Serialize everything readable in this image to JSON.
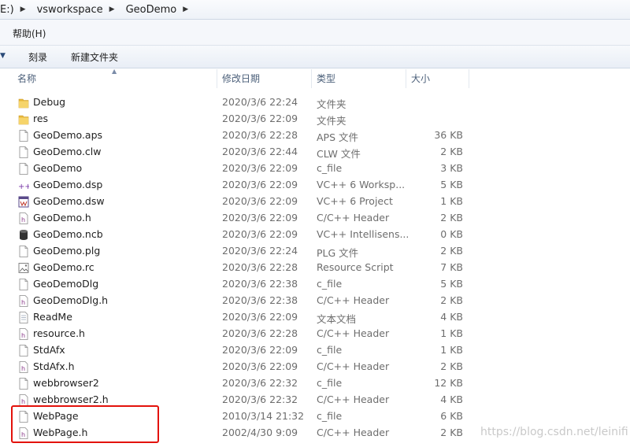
{
  "address": {
    "drive": "E:)",
    "crumbs": [
      "vsworkspace",
      "GeoDemo"
    ]
  },
  "menu": {
    "help": "帮助(H)"
  },
  "toolbar": {
    "burn": "刻录",
    "new_folder": "新建文件夹"
  },
  "columns": {
    "name": "名称",
    "date": "修改日期",
    "type": "类型",
    "size": "大小"
  },
  "files": [
    {
      "name": "Debug",
      "date": "2020/3/6 22:24",
      "type": "文件夹",
      "size": "",
      "icon": "folder-icon"
    },
    {
      "name": "res",
      "date": "2020/3/6 22:09",
      "type": "文件夹",
      "size": "",
      "icon": "folder-icon"
    },
    {
      "name": "GeoDemo.aps",
      "date": "2020/3/6 22:28",
      "type": "APS 文件",
      "size": "36 KB",
      "icon": "file-icon"
    },
    {
      "name": "GeoDemo.clw",
      "date": "2020/3/6 22:44",
      "type": "CLW 文件",
      "size": "2 KB",
      "icon": "file-icon"
    },
    {
      "name": "GeoDemo",
      "date": "2020/3/6 22:09",
      "type": "c_file",
      "size": "3 KB",
      "icon": "file-icon"
    },
    {
      "name": "GeoDemo.dsp",
      "date": "2020/3/6 22:09",
      "type": "VC++ 6 Worksp...",
      "size": "5 KB",
      "icon": "vc-project-icon"
    },
    {
      "name": "GeoDemo.dsw",
      "date": "2020/3/6 22:09",
      "type": "VC++ 6 Project",
      "size": "1 KB",
      "icon": "vc-workspace-icon"
    },
    {
      "name": "GeoDemo.h",
      "date": "2020/3/6 22:09",
      "type": "C/C++ Header",
      "size": "2 KB",
      "icon": "header-file-icon"
    },
    {
      "name": "GeoDemo.ncb",
      "date": "2020/3/6 22:09",
      "type": "VC++ Intellisens...",
      "size": "0 KB",
      "icon": "database-icon"
    },
    {
      "name": "GeoDemo.plg",
      "date": "2020/3/6 22:24",
      "type": "PLG 文件",
      "size": "2 KB",
      "icon": "file-icon"
    },
    {
      "name": "GeoDemo.rc",
      "date": "2020/3/6 22:28",
      "type": "Resource Script",
      "size": "7 KB",
      "icon": "resource-script-icon"
    },
    {
      "name": "GeoDemoDlg",
      "date": "2020/3/6 22:38",
      "type": "c_file",
      "size": "5 KB",
      "icon": "file-icon"
    },
    {
      "name": "GeoDemoDlg.h",
      "date": "2020/3/6 22:38",
      "type": "C/C++ Header",
      "size": "2 KB",
      "icon": "header-file-icon"
    },
    {
      "name": "ReadMe",
      "date": "2020/3/6 22:09",
      "type": "文本文档",
      "size": "4 KB",
      "icon": "text-file-icon"
    },
    {
      "name": "resource.h",
      "date": "2020/3/6 22:28",
      "type": "C/C++ Header",
      "size": "1 KB",
      "icon": "header-file-icon"
    },
    {
      "name": "StdAfx",
      "date": "2020/3/6 22:09",
      "type": "c_file",
      "size": "1 KB",
      "icon": "file-icon"
    },
    {
      "name": "StdAfx.h",
      "date": "2020/3/6 22:09",
      "type": "C/C++ Header",
      "size": "2 KB",
      "icon": "header-file-icon"
    },
    {
      "name": "webbrowser2",
      "date": "2020/3/6 22:32",
      "type": "c_file",
      "size": "12 KB",
      "icon": "file-icon"
    },
    {
      "name": "webbrowser2.h",
      "date": "2020/3/6 22:32",
      "type": "C/C++ Header",
      "size": "4 KB",
      "icon": "header-file-icon"
    },
    {
      "name": "WebPage",
      "date": "2010/3/14 21:32",
      "type": "c_file",
      "size": "6 KB",
      "icon": "file-icon"
    },
    {
      "name": "WebPage.h",
      "date": "2002/4/30 9:09",
      "type": "C/C++ Header",
      "size": "2 KB",
      "icon": "header-file-icon"
    }
  ],
  "watermark": "https://blog.csdn.net/leinifi",
  "colors": {
    "highlight_box": "#e3120b",
    "folder": "#e8b93a"
  }
}
